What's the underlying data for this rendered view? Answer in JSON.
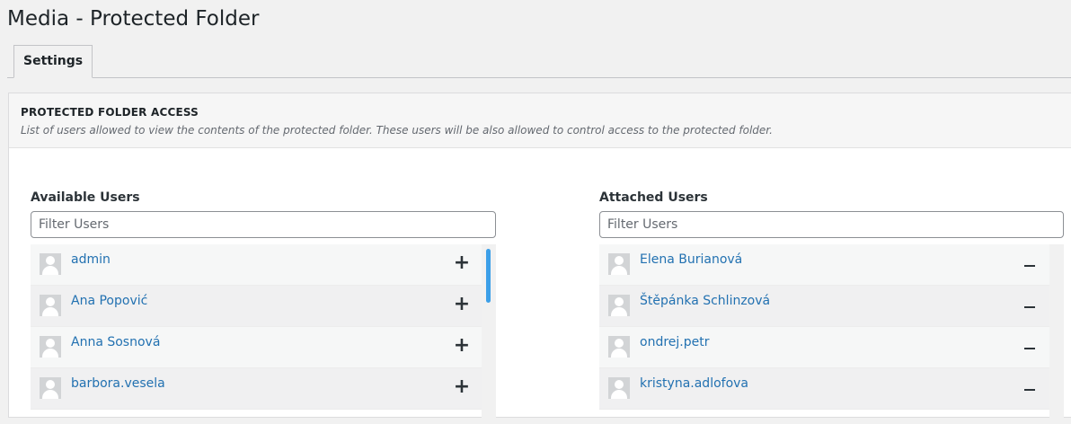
{
  "page": {
    "title": "Media - Protected Folder"
  },
  "tabs": [
    {
      "label": "Settings",
      "active": true
    }
  ],
  "section": {
    "heading": "PROTECTED FOLDER ACCESS",
    "description": "List of users allowed to view the contents of the protected folder. These users will be also allowed to control access to the protected folder."
  },
  "available": {
    "title": "Available Users",
    "filter_placeholder": "Filter Users",
    "filter_value": "",
    "action_icon": "plus-icon",
    "users": [
      {
        "name": "admin",
        "avatar": "default-avatar"
      },
      {
        "name": "Ana Popović",
        "avatar": "default-avatar"
      },
      {
        "name": "Anna Sosnová",
        "avatar": "default-avatar"
      },
      {
        "name": "barbora.vesela",
        "avatar": "default-avatar"
      }
    ]
  },
  "attached": {
    "title": "Attached Users",
    "filter_placeholder": "Filter Users",
    "filter_value": "",
    "action_icon": "minus-icon",
    "users": [
      {
        "name": "Elena Burianová",
        "avatar": "default-avatar"
      },
      {
        "name": "Štěpánka Schlinzová",
        "avatar": "default-avatar"
      },
      {
        "name": "ondrej.petr",
        "avatar": "default-avatar"
      },
      {
        "name": "kristyna.adlofova",
        "avatar": "default-avatar"
      }
    ]
  },
  "colors": {
    "link": "#2271b1",
    "scroll_thumb": "#3c9fe8",
    "page_bg": "#f1f1f1"
  }
}
